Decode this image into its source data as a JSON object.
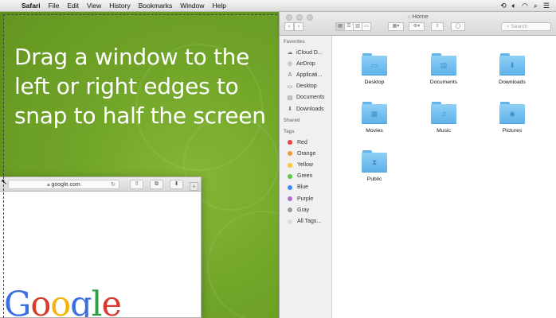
{
  "menubar": {
    "apple": "",
    "app": "Safari",
    "items": [
      "File",
      "Edit",
      "View",
      "History",
      "Bookmarks",
      "Window",
      "Help"
    ],
    "status_icons": [
      "timemachine-icon",
      "volume-icon",
      "wifi-icon",
      "search-icon",
      "list-icon"
    ]
  },
  "desktop": {
    "headline": "Drag a window to the left or right edges to snap to half the screen"
  },
  "safari": {
    "url": "google.com",
    "page_logo": [
      "G",
      "o",
      "o",
      "g",
      "l",
      "e"
    ],
    "logo_colors": [
      "#3b6fe0",
      "#d83a2c",
      "#f2b40c",
      "#3b6fe0",
      "#2f9e44",
      "#d83a2c"
    ]
  },
  "finder": {
    "title": "Home",
    "search_placeholder": "Search",
    "sidebar": {
      "favorites_label": "Favorites",
      "favorites": [
        {
          "label": "iCloud D...",
          "icon": "cloud-icon"
        },
        {
          "label": "AirDrop",
          "icon": "airdrop-icon"
        },
        {
          "label": "Applicati...",
          "icon": "applications-icon"
        },
        {
          "label": "Desktop",
          "icon": "desktop-icon"
        },
        {
          "label": "Documents",
          "icon": "documents-icon"
        },
        {
          "label": "Downloads",
          "icon": "downloads-icon"
        }
      ],
      "shared_label": "Shared",
      "tags_label": "Tags",
      "tags": [
        {
          "label": "Red",
          "color": "#f0423f"
        },
        {
          "label": "Orange",
          "color": "#f79a2a"
        },
        {
          "label": "Yellow",
          "color": "#f3cb2b"
        },
        {
          "label": "Green",
          "color": "#5cc942"
        },
        {
          "label": "Blue",
          "color": "#3a8cf2"
        },
        {
          "label": "Purple",
          "color": "#b569d4"
        },
        {
          "label": "Gray",
          "color": "#9a9a9a"
        },
        {
          "label": "All Tags...",
          "color": "#dddddd"
        }
      ]
    },
    "folders": [
      {
        "label": "Desktop",
        "glyph": "▭"
      },
      {
        "label": "Documents",
        "glyph": "▤"
      },
      {
        "label": "Downloads",
        "glyph": "⬇"
      },
      {
        "label": "Movies",
        "glyph": "▦"
      },
      {
        "label": "Music",
        "glyph": "♫"
      },
      {
        "label": "Pictures",
        "glyph": "◉"
      },
      {
        "label": "Public",
        "glyph": "⧗"
      }
    ]
  }
}
